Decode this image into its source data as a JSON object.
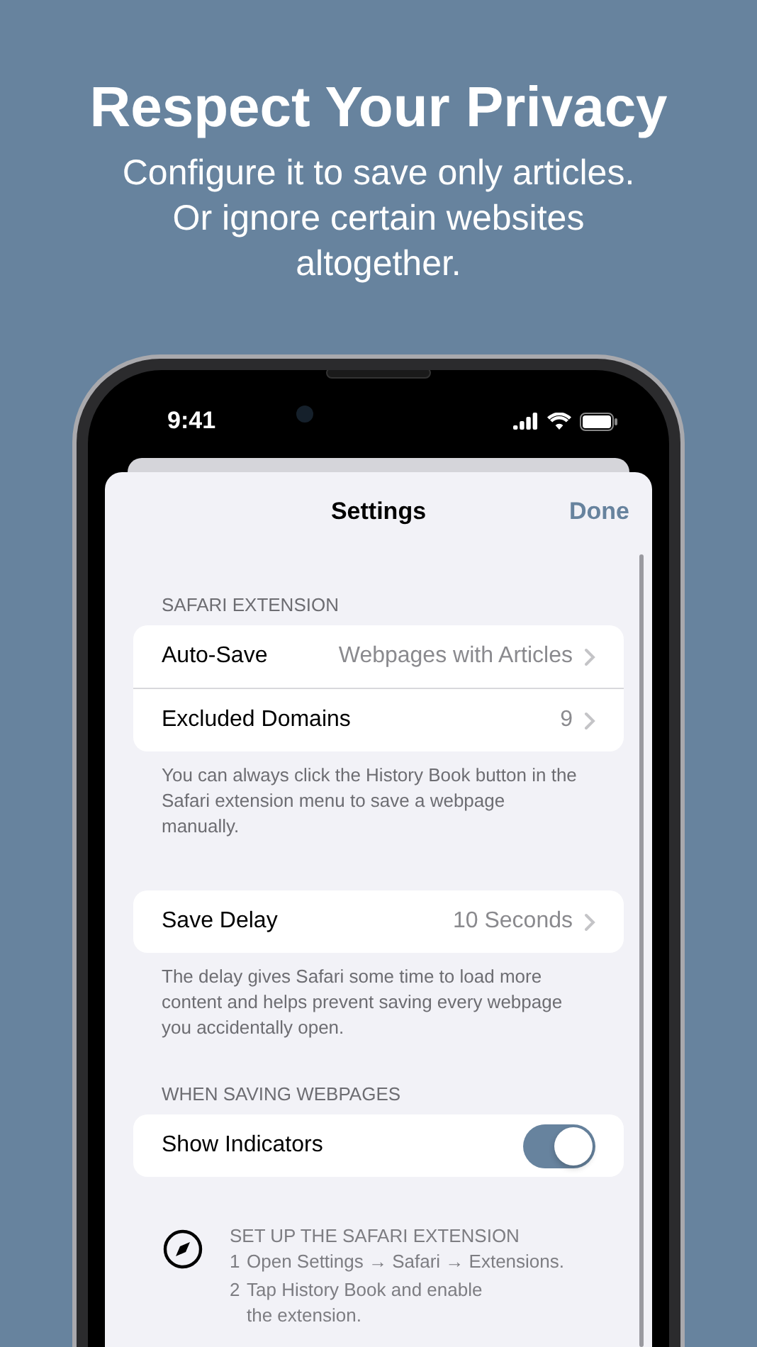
{
  "headline": "Respect Your Privacy",
  "subtitle_lines": [
    "Configure it to save only articles.",
    "Or ignore certain websites altogether."
  ],
  "status_bar": {
    "time": "9:41"
  },
  "nav": {
    "title": "Settings",
    "done": "Done"
  },
  "sections": [
    {
      "header": "SAFARI EXTENSION",
      "rows": [
        {
          "kind": "link",
          "label": "Auto-Save",
          "value": "Webpages with Articles"
        },
        {
          "kind": "link",
          "label": "Excluded Domains",
          "value": "9"
        }
      ],
      "footer": "You can always click the History Book button in the Safari extension menu to save a webpage manually."
    },
    {
      "rows": [
        {
          "kind": "link",
          "label": "Save Delay",
          "value": "10 Seconds"
        }
      ],
      "footer": "The delay gives Safari some time to load more content and helps prevent saving every webpage you accidentally open."
    },
    {
      "header": "WHEN SAVING WEBPAGES",
      "rows": [
        {
          "kind": "toggle",
          "label": "Show Indicators",
          "on": true
        }
      ]
    }
  ],
  "setup": {
    "title": "SET UP THE SAFARI EXTENSION",
    "steps": [
      {
        "number": "1",
        "text": "Open Settings → Safari → Extensions."
      },
      {
        "number": "2",
        "text": "Tap History Book and enable the extension."
      }
    ]
  }
}
